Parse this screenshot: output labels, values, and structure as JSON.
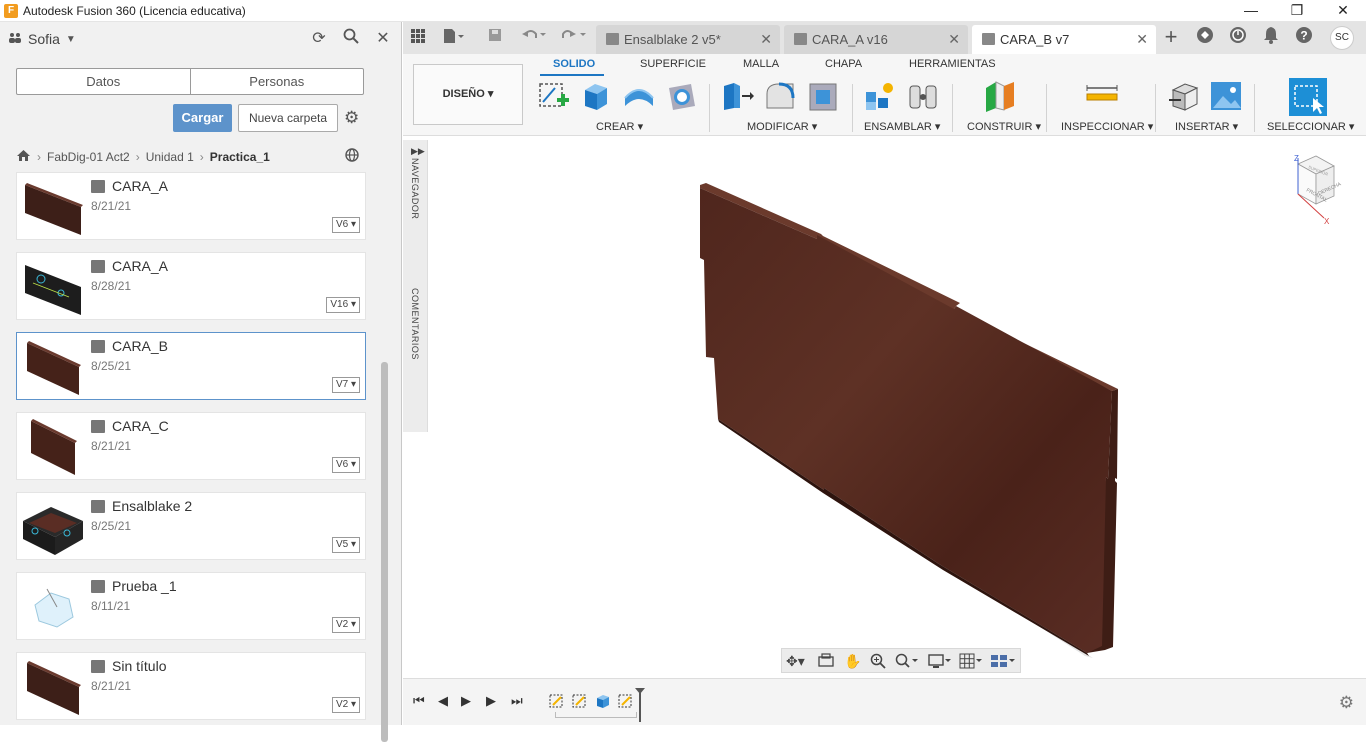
{
  "window": {
    "title": "Autodesk Fusion 360 (Licencia educativa)",
    "app_icon_letter": "F",
    "minimize": "—",
    "restore": "❐",
    "close": "✕"
  },
  "left_panel": {
    "user_name": "Sofia",
    "tabs": [
      "Datos",
      "Personas"
    ],
    "upload_label": "Cargar",
    "new_folder_label": "Nueva carpeta",
    "breadcrumb": [
      "FabDig-01 Act2",
      "Unidad 1",
      "Practica_1"
    ],
    "files": [
      {
        "name": "CARA_A",
        "date": "8/21/21",
        "version": "V6",
        "thumb": "dark-board"
      },
      {
        "name": "CARA_A",
        "date": "8/28/21",
        "version": "V16",
        "thumb": "dark-board-blue"
      },
      {
        "name": "CARA_B",
        "date": "8/25/21",
        "version": "V7",
        "thumb": "dark-board",
        "selected": true
      },
      {
        "name": "CARA_C",
        "date": "8/21/21",
        "version": "V6",
        "thumb": "dark-board"
      },
      {
        "name": "Ensalblake 2",
        "date": "8/25/21",
        "version": "V5",
        "thumb": "box-assembly"
      },
      {
        "name": "Prueba _1",
        "date": "8/11/21",
        "version": "V2",
        "thumb": "light-sketch"
      },
      {
        "name": "Sin título",
        "date": "8/21/21",
        "version": "V2",
        "thumb": "dark-board"
      }
    ]
  },
  "doc_tabs": [
    {
      "label": "Ensalblake 2 v5*",
      "active": false
    },
    {
      "label": "CARA_A v16",
      "active": false
    },
    {
      "label": "CARA_B v7",
      "active": true
    }
  ],
  "user_initials": "SC",
  "toolbar": {
    "workspace_label": "DISEÑO",
    "workspace_tabs": [
      "SOLIDO",
      "SUPERFICIE",
      "MALLA",
      "CHAPA",
      "HERRAMIENTAS"
    ],
    "active_tab": "SOLIDO",
    "groups": [
      "CREAR",
      "MODIFICAR",
      "ENSAMBLAR",
      "CONSTRUIR",
      "INSPECCIONAR",
      "INSERTAR",
      "SELECCIONAR"
    ]
  },
  "side_panels": {
    "navigator": "NAVEGADOR",
    "comments": "COMENTARIOS"
  },
  "viewcube": {
    "top_label": "SUPERIOR",
    "front_label": "FRONTAL",
    "right_label": "DERECHA",
    "axis_z": "Z",
    "axis_x": "X"
  },
  "colors": {
    "accent": "#1d76c3",
    "upload_button": "#5d93cb",
    "wood": "#5a2d24"
  }
}
